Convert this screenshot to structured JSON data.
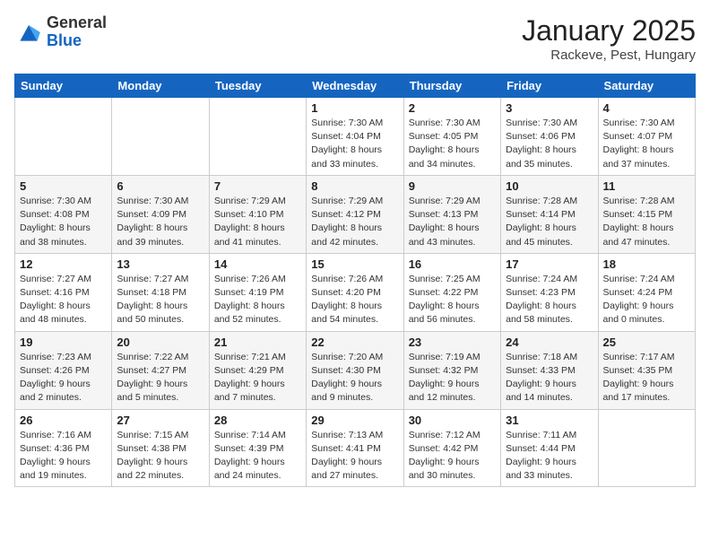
{
  "header": {
    "logo_general": "General",
    "logo_blue": "Blue",
    "month_title": "January 2025",
    "location": "Rackeve, Pest, Hungary"
  },
  "weekdays": [
    "Sunday",
    "Monday",
    "Tuesday",
    "Wednesday",
    "Thursday",
    "Friday",
    "Saturday"
  ],
  "weeks": [
    [
      {
        "day": "",
        "info": ""
      },
      {
        "day": "",
        "info": ""
      },
      {
        "day": "",
        "info": ""
      },
      {
        "day": "1",
        "info": "Sunrise: 7:30 AM\nSunset: 4:04 PM\nDaylight: 8 hours\nand 33 minutes."
      },
      {
        "day": "2",
        "info": "Sunrise: 7:30 AM\nSunset: 4:05 PM\nDaylight: 8 hours\nand 34 minutes."
      },
      {
        "day": "3",
        "info": "Sunrise: 7:30 AM\nSunset: 4:06 PM\nDaylight: 8 hours\nand 35 minutes."
      },
      {
        "day": "4",
        "info": "Sunrise: 7:30 AM\nSunset: 4:07 PM\nDaylight: 8 hours\nand 37 minutes."
      }
    ],
    [
      {
        "day": "5",
        "info": "Sunrise: 7:30 AM\nSunset: 4:08 PM\nDaylight: 8 hours\nand 38 minutes."
      },
      {
        "day": "6",
        "info": "Sunrise: 7:30 AM\nSunset: 4:09 PM\nDaylight: 8 hours\nand 39 minutes."
      },
      {
        "day": "7",
        "info": "Sunrise: 7:29 AM\nSunset: 4:10 PM\nDaylight: 8 hours\nand 41 minutes."
      },
      {
        "day": "8",
        "info": "Sunrise: 7:29 AM\nSunset: 4:12 PM\nDaylight: 8 hours\nand 42 minutes."
      },
      {
        "day": "9",
        "info": "Sunrise: 7:29 AM\nSunset: 4:13 PM\nDaylight: 8 hours\nand 43 minutes."
      },
      {
        "day": "10",
        "info": "Sunrise: 7:28 AM\nSunset: 4:14 PM\nDaylight: 8 hours\nand 45 minutes."
      },
      {
        "day": "11",
        "info": "Sunrise: 7:28 AM\nSunset: 4:15 PM\nDaylight: 8 hours\nand 47 minutes."
      }
    ],
    [
      {
        "day": "12",
        "info": "Sunrise: 7:27 AM\nSunset: 4:16 PM\nDaylight: 8 hours\nand 48 minutes."
      },
      {
        "day": "13",
        "info": "Sunrise: 7:27 AM\nSunset: 4:18 PM\nDaylight: 8 hours\nand 50 minutes."
      },
      {
        "day": "14",
        "info": "Sunrise: 7:26 AM\nSunset: 4:19 PM\nDaylight: 8 hours\nand 52 minutes."
      },
      {
        "day": "15",
        "info": "Sunrise: 7:26 AM\nSunset: 4:20 PM\nDaylight: 8 hours\nand 54 minutes."
      },
      {
        "day": "16",
        "info": "Sunrise: 7:25 AM\nSunset: 4:22 PM\nDaylight: 8 hours\nand 56 minutes."
      },
      {
        "day": "17",
        "info": "Sunrise: 7:24 AM\nSunset: 4:23 PM\nDaylight: 8 hours\nand 58 minutes."
      },
      {
        "day": "18",
        "info": "Sunrise: 7:24 AM\nSunset: 4:24 PM\nDaylight: 9 hours\nand 0 minutes."
      }
    ],
    [
      {
        "day": "19",
        "info": "Sunrise: 7:23 AM\nSunset: 4:26 PM\nDaylight: 9 hours\nand 2 minutes."
      },
      {
        "day": "20",
        "info": "Sunrise: 7:22 AM\nSunset: 4:27 PM\nDaylight: 9 hours\nand 5 minutes."
      },
      {
        "day": "21",
        "info": "Sunrise: 7:21 AM\nSunset: 4:29 PM\nDaylight: 9 hours\nand 7 minutes."
      },
      {
        "day": "22",
        "info": "Sunrise: 7:20 AM\nSunset: 4:30 PM\nDaylight: 9 hours\nand 9 minutes."
      },
      {
        "day": "23",
        "info": "Sunrise: 7:19 AM\nSunset: 4:32 PM\nDaylight: 9 hours\nand 12 minutes."
      },
      {
        "day": "24",
        "info": "Sunrise: 7:18 AM\nSunset: 4:33 PM\nDaylight: 9 hours\nand 14 minutes."
      },
      {
        "day": "25",
        "info": "Sunrise: 7:17 AM\nSunset: 4:35 PM\nDaylight: 9 hours\nand 17 minutes."
      }
    ],
    [
      {
        "day": "26",
        "info": "Sunrise: 7:16 AM\nSunset: 4:36 PM\nDaylight: 9 hours\nand 19 minutes."
      },
      {
        "day": "27",
        "info": "Sunrise: 7:15 AM\nSunset: 4:38 PM\nDaylight: 9 hours\nand 22 minutes."
      },
      {
        "day": "28",
        "info": "Sunrise: 7:14 AM\nSunset: 4:39 PM\nDaylight: 9 hours\nand 24 minutes."
      },
      {
        "day": "29",
        "info": "Sunrise: 7:13 AM\nSunset: 4:41 PM\nDaylight: 9 hours\nand 27 minutes."
      },
      {
        "day": "30",
        "info": "Sunrise: 7:12 AM\nSunset: 4:42 PM\nDaylight: 9 hours\nand 30 minutes."
      },
      {
        "day": "31",
        "info": "Sunrise: 7:11 AM\nSunset: 4:44 PM\nDaylight: 9 hours\nand 33 minutes."
      },
      {
        "day": "",
        "info": ""
      }
    ]
  ]
}
